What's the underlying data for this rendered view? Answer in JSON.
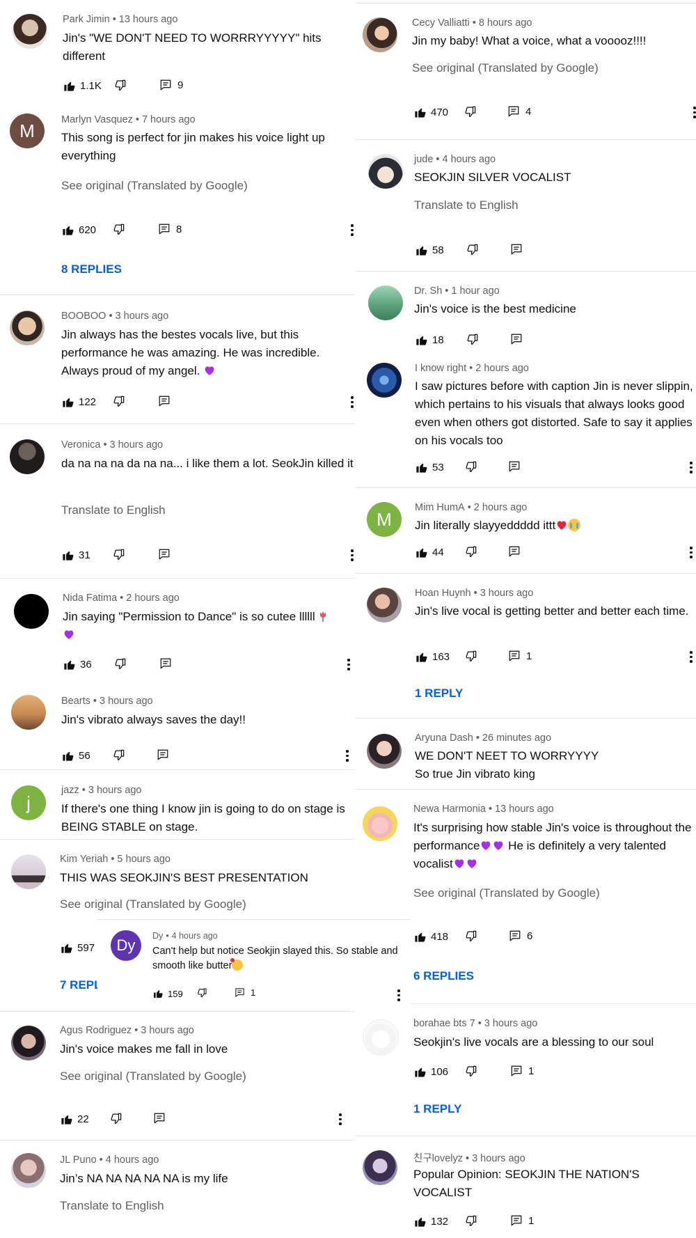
{
  "labels": {
    "see_original": "See original (Translated by Google)",
    "translate": "Translate to English"
  },
  "icons": {
    "like": "thumbs-up-icon",
    "dislike": "thumbs-down-icon",
    "reply": "reply-icon",
    "menu": "more-vertical-icon"
  },
  "colors": {
    "link": "#065fd4",
    "meta": "#606060",
    "divider": "#e5e5e5",
    "purple_heart": "#a62ee6",
    "red_heart": "#e0263b"
  },
  "left": [
    {
      "author": "Park Jimin",
      "time": "13 hours ago",
      "text": "Jin's \"WE DON'T NEED TO WORRRYYYYY\" hits different",
      "likes": "1.1K",
      "replies_count": "9"
    },
    {
      "author": "Marlyn Vasquez",
      "time": "7 hours ago",
      "avatar_letter": "M",
      "text": "This song is perfect for jin makes his voice light up everything",
      "likes": "620",
      "replies_count": "8",
      "replies_label": "8 REPLIES"
    },
    {
      "author": "BOOBOO",
      "time": "3 hours ago",
      "text": "Jin always has the bestes vocals live, but this performance he was amazing. He was incredible. Always proud of my angel.",
      "likes": "122"
    },
    {
      "author": "Veronica",
      "time": "3 hours ago",
      "text": "da na na na  da na na... i like them a lot. SeokJin killed it",
      "likes": "31"
    },
    {
      "author": "Nida Fatima",
      "time": "2 hours ago",
      "text": "Jin saying \"Permission to Dance\" is so cutee llllll",
      "likes": "36"
    },
    {
      "author": "Bearts",
      "time": "3 hours ago",
      "text": "Jin's vibrato always saves the day!!",
      "likes": "56"
    },
    {
      "author": "jazz",
      "time": "3 hours ago",
      "avatar_letter": "j",
      "text": "If there's one thing I know jin is going to do on stage is BEING STABLE on stage."
    },
    {
      "author": "Kim Yeriah",
      "time": "5 hours ago",
      "text": "THIS WAS SEOKJIN'S BEST PRESENTATION",
      "likes": "597",
      "replies_label": "7 REPL"
    },
    {
      "author": "Agus Rodriguez",
      "time": "3 hours ago",
      "text": "Jin's voice makes me fall in love",
      "likes": "22"
    },
    {
      "author": "JL Puno",
      "time": "4 hours ago",
      "text": "Jin’s NA NA NA NA NA is my life"
    }
  ],
  "nested": {
    "author": "Dy",
    "time": "4 hours ago",
    "avatar_letter": "Dy",
    "text": "Can't help but notice Seokjin slayed this. So stable and smooth like butter",
    "likes": "159",
    "replies_count": "1"
  },
  "right": [
    {
      "author": "Cecy Valliatti",
      "time": "8 hours ago",
      "text": "Jin my baby! What a voice, what a vooooz!!!!",
      "likes": "470",
      "replies_count": "4"
    },
    {
      "author": "jude",
      "time": "4 hours ago",
      "text": "SEOKJIN SILVER VOCALIST",
      "likes": "58"
    },
    {
      "author": "Dr. Sh",
      "time": "1 hour ago",
      "text": "Jin's voice is the best medicine",
      "likes": "18"
    },
    {
      "author": "I know right",
      "time": "2 hours ago",
      "text": "I saw pictures before with caption Jin is never slippin, which pertains to his visuals that always looks good even when others got distorted. Safe to say it applies on his vocals too",
      "likes": "53"
    },
    {
      "author": "Mim HumA",
      "time": "2 hours ago",
      "avatar_letter": "M",
      "text": "Jin literally slayyeddddd ittt",
      "likes": "44"
    },
    {
      "author": "Hoan Huynh",
      "time": "3 hours ago",
      "text": "Jin's live vocal is getting better and better each time.",
      "likes": "163",
      "replies_count": "1",
      "replies_label": "1 REPLY"
    },
    {
      "author": "Aryuna Dash",
      "time": "26 minutes ago",
      "text": "WE DON'T NEET TO WORRYYYY",
      "text2": "So true Jin vibrato king"
    },
    {
      "author": "Newa Harmonia",
      "time": "13 hours ago",
      "text": "It's surprising how stable Jin's voice is throughout the performance",
      "text_after": " He is definitely a very talented vocalist",
      "likes": "418",
      "replies_count": "6",
      "replies_label": "6 REPLIES"
    },
    {
      "author": "borahae bts 7",
      "time": "3 hours ago",
      "text": "Seokjin's live vocals are a blessing to our soul",
      "likes": "106",
      "replies_count": "1",
      "replies_label": "1 REPLY"
    },
    {
      "author": "친구lovelyz",
      "time": "3 hours ago",
      "text": "Popular Opinion: SEOKJIN THE NATION'S VOCALIST",
      "likes": "132",
      "replies_count": "1"
    }
  ]
}
